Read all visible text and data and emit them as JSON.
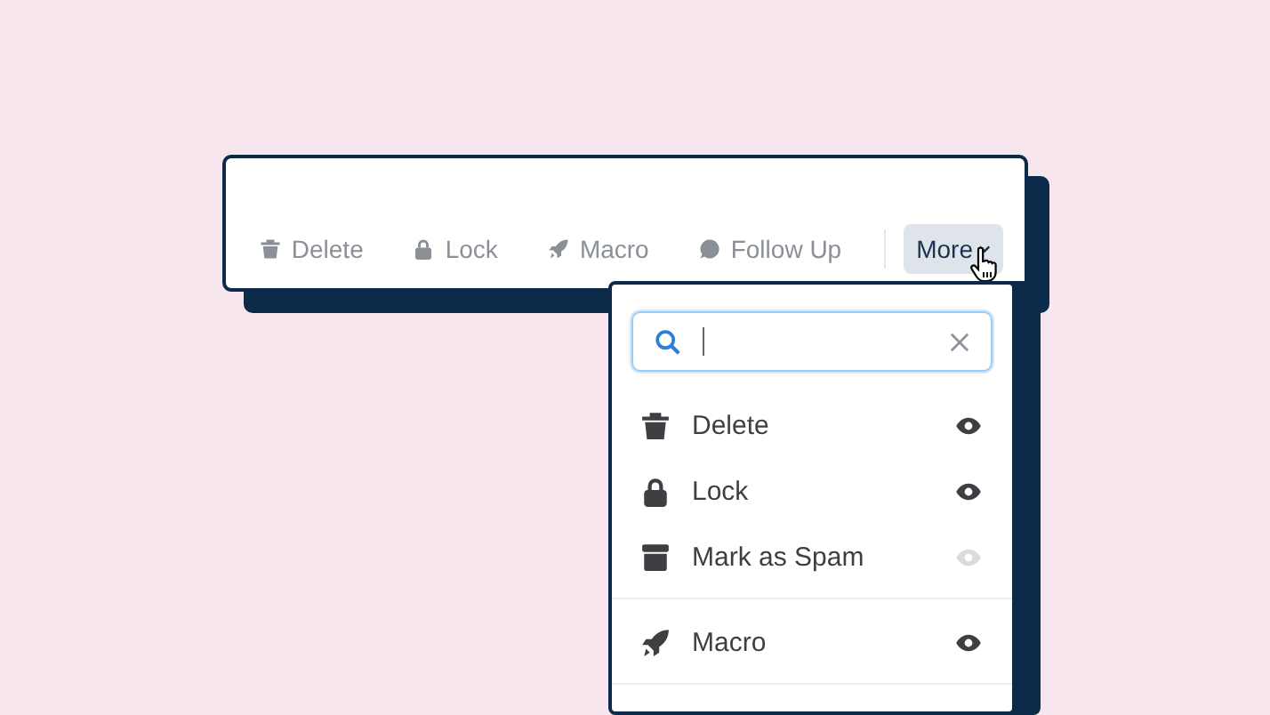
{
  "toolbar": {
    "actions": [
      {
        "label": "Delete",
        "kind": "trash"
      },
      {
        "label": "Lock",
        "kind": "lock"
      },
      {
        "label": "Macro",
        "kind": "rocket"
      },
      {
        "label": "Follow Up",
        "kind": "chat"
      }
    ],
    "more_button": {
      "label": "More",
      "selected": true
    }
  },
  "menu": {
    "search": {
      "focused": true
    },
    "groups": [
      {
        "items": [
          {
            "label": "Delete",
            "kind": "trash",
            "visible": true
          },
          {
            "label": "Lock",
            "kind": "lock",
            "visible": true
          },
          {
            "label": "Mark as Spam",
            "kind": "archive",
            "visible": false
          }
        ]
      },
      {
        "items": [
          {
            "label": "Macro",
            "kind": "rocket",
            "visible": true
          }
        ]
      }
    ]
  }
}
